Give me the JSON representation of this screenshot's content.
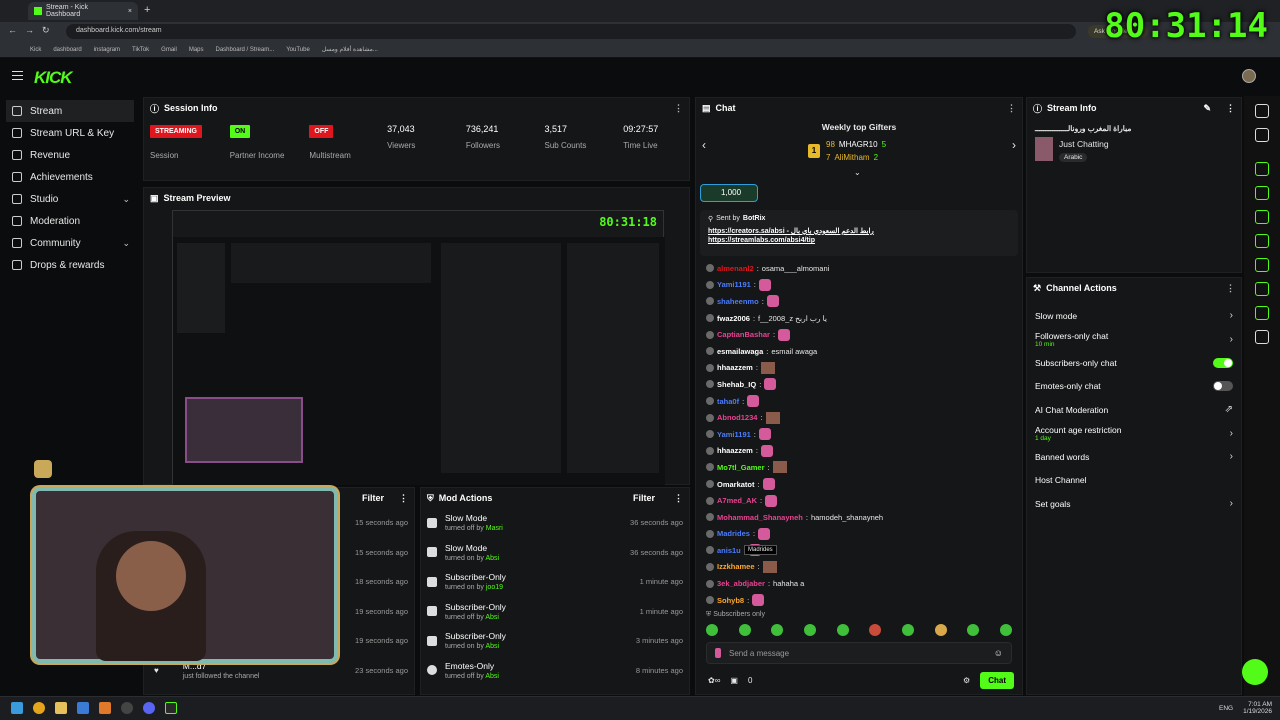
{
  "browser": {
    "tab_title": "Stream - Kick Dashboard",
    "url": "dashboard.kick.com/stream",
    "bookmarks": [
      "Kick",
      "dashboard",
      "instagram",
      "TikTok",
      "Gmail",
      "Maps",
      "Dashboard / Stream...",
      "YouTube",
      "مشاهدة أفلام ومسل..."
    ],
    "ask_google": "Ask Google"
  },
  "overlay_timer": "80:31:14",
  "brand": "KICK",
  "sidebar": {
    "items": [
      {
        "label": "Stream",
        "icon": "broadcast-icon"
      },
      {
        "label": "Stream URL & Key",
        "icon": "link-icon"
      },
      {
        "label": "Revenue",
        "icon": "revenue-icon"
      },
      {
        "label": "Achievements",
        "icon": "trophy-icon"
      },
      {
        "label": "Studio",
        "icon": "studio-icon"
      },
      {
        "label": "Moderation",
        "icon": "wrench-icon"
      },
      {
        "label": "Community",
        "icon": "community-icon"
      },
      {
        "label": "Drops & rewards",
        "icon": "gift-icon"
      }
    ]
  },
  "session_info": {
    "title": "Session Info",
    "stats": [
      {
        "value": "STREAMING",
        "label": "Session",
        "type": "badge",
        "color": "#e0161e"
      },
      {
        "value": "ON",
        "label": "Partner Income",
        "type": "badge",
        "color": "#53fc18"
      },
      {
        "value": "OFF",
        "label": "Multistream",
        "type": "badge",
        "color": "#e0161e"
      },
      {
        "value": "37,043",
        "label": "Viewers"
      },
      {
        "value": "736,241",
        "label": "Followers"
      },
      {
        "value": "3,517",
        "label": "Sub Counts"
      },
      {
        "value": "09:27:57",
        "label": "Time Live"
      }
    ]
  },
  "stream_preview": {
    "title": "Stream Preview",
    "inner_timer": "80:31:18"
  },
  "activity": {
    "filter": "Filter",
    "events": [
      {
        "time": "15 seconds ago"
      },
      {
        "time": "15 seconds ago"
      },
      {
        "time": "18 seconds ago"
      },
      {
        "time": "19 seconds ago"
      },
      {
        "time": "19 seconds ago"
      },
      {
        "time": "23 seconds ago",
        "text": "M...d7",
        "sub": "just followed the channel"
      }
    ]
  },
  "mod_actions": {
    "title": "Mod Actions",
    "filter": "Filter",
    "items": [
      {
        "action": "Slow Mode",
        "detail": "turned off by",
        "user": "Masri",
        "time": "36 seconds ago"
      },
      {
        "action": "Slow Mode",
        "detail": "turned on by",
        "user": "Absi",
        "time": "36 seconds ago"
      },
      {
        "action": "Subscriber-Only",
        "detail": "turned on by",
        "user": "joo19",
        "time": "1 minute ago"
      },
      {
        "action": "Subscriber-Only",
        "detail": "turned off by",
        "user": "Absi",
        "time": "1 minute ago"
      },
      {
        "action": "Subscriber-Only",
        "detail": "turned on by",
        "user": "Absi",
        "time": "3 minutes ago"
      },
      {
        "action": "Emotes-Only",
        "detail": "turned off by",
        "user": "Absi",
        "time": "8 minutes ago"
      }
    ]
  },
  "chat": {
    "title": "Chat",
    "gifters_title": "Weekly top Gifters",
    "gifter_rank": "1",
    "gifter1_count": "98",
    "gifter1": "MHAGR10",
    "gifter1_subs": "5",
    "gifter2_count": "7",
    "gifter2": "AliMitham",
    "gifter2_subs": "2",
    "kicks": "1,000",
    "pinned_sent_by": "Sent by",
    "pinned_author": "BotRix",
    "pinned_line1": "https://creators.sa/absi - رابط الدعم السعودي باي بال",
    "pinned_line2": "https://streamlabs.com/absi4/tip",
    "messages": [
      {
        "user": "almenanl2",
        "color": "#e0161e",
        "text": "osama___almomani"
      },
      {
        "user": "Yami1191",
        "color": "#4a7dff",
        "text": "",
        "emote": true
      },
      {
        "user": "shaheenmo",
        "color": "#4a7dff",
        "text": "",
        "emote": true
      },
      {
        "user": "fwaz2006",
        "color": "#ffffff",
        "text": "f__2008_z يا رب اربح"
      },
      {
        "user": "CaptianBashar",
        "color": "#e84393",
        "text": "",
        "emote": true
      },
      {
        "user": "esmailawaga",
        "color": "#ffffff",
        "text": "esmail awaga"
      },
      {
        "user": "hhaazzem",
        "color": "#ffffff",
        "text": "",
        "emote": true
      },
      {
        "user": "Shehab_IQ",
        "color": "#ffffff",
        "text": "",
        "emote": true
      },
      {
        "user": "taha0f",
        "color": "#4a7dff",
        "text": "",
        "emote": true
      },
      {
        "user": "Abnod1234",
        "color": "#e84393",
        "text": "",
        "emote": true
      },
      {
        "user": "Yami1191",
        "color": "#4a7dff",
        "text": "",
        "emote": true
      },
      {
        "user": "hhaazzem",
        "color": "#ffffff",
        "text": "",
        "emote": true
      },
      {
        "user": "Mo7tl_Gamer",
        "color": "#53fc18",
        "text": "",
        "emote": true
      },
      {
        "user": "Omarkatot",
        "color": "#ffffff",
        "text": "",
        "emote": true
      },
      {
        "user": "A7med_AK",
        "color": "#e84393",
        "text": "",
        "emote": true
      },
      {
        "user": "Mohammad_Shanayneh",
        "color": "#e84393",
        "text": "hamodeh_shanayneh"
      },
      {
        "user": "Madrides",
        "color": "#4a7dff",
        "text": "",
        "emote": true
      },
      {
        "user": "anis1u",
        "color": "#4a7dff",
        "text": "",
        "emote": true
      },
      {
        "user": "Izzkhamee",
        "color": "#ffa82e",
        "text": "",
        "emote": true
      },
      {
        "user": "3ek_abdjaber",
        "color": "#e84393",
        "text": "hahaha a"
      },
      {
        "user": "Sohyb8",
        "color": "#ffa82e",
        "text": "",
        "emote": true
      }
    ],
    "tooltip": "Madrides",
    "subscribers_only": "Subscribers only",
    "input_placeholder": "Send a message",
    "kicks_balance": "0",
    "send_label": "Chat"
  },
  "stream_info": {
    "title": "Stream Info",
    "stream_title": "مباراة المغرب ورونالـــــــــــــــ",
    "category": "Just Chatting",
    "language": "Arabic"
  },
  "channel_actions": {
    "title": "Channel Actions",
    "items": [
      {
        "label": "Slow mode",
        "control": "arrow"
      },
      {
        "label": "Followers-only chat",
        "sub": "10 min",
        "control": "arrow"
      },
      {
        "label": "Subscribers-only chat",
        "control": "toggle-on"
      },
      {
        "label": "Emotes-only chat",
        "control": "toggle-off"
      },
      {
        "label": "AI Chat Moderation",
        "control": "external"
      },
      {
        "label": "Account age restriction",
        "sub": "1 day",
        "control": "arrow"
      },
      {
        "label": "Banned words",
        "control": "arrow"
      },
      {
        "label": "Host Channel",
        "control": "none"
      },
      {
        "label": "Set goals",
        "control": "arrow"
      }
    ]
  },
  "taskbar": {
    "lang": "ENG",
    "time": "7:01 AM",
    "date": "1/19/2026"
  },
  "colors": {
    "accent": "#53fc18",
    "danger": "#e0161e",
    "panel": "#151617",
    "bg": "#0b0c0d"
  }
}
